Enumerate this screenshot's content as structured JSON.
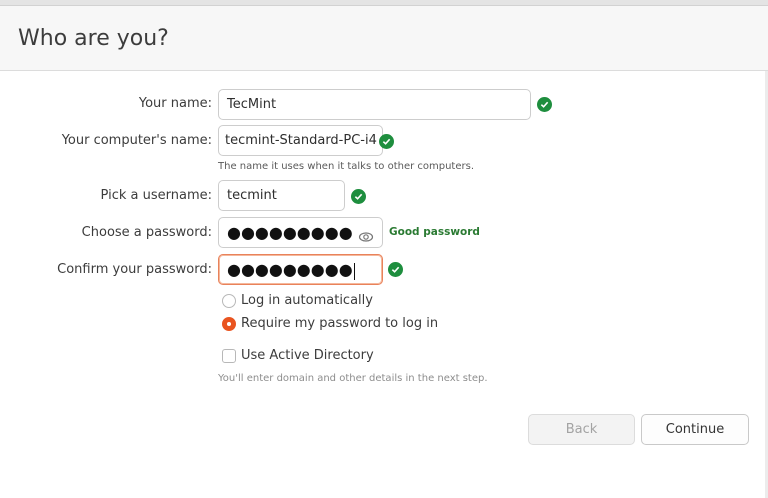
{
  "header": {
    "title": "Who are you?"
  },
  "form": {
    "name_label": "Your name:",
    "name_value": "TecMint",
    "computer_label": "Your computer's name:",
    "computer_value": "tecmint-Standard-PC-i4",
    "computer_hint": "The name it uses when it talks to other computers.",
    "username_label": "Pick a username:",
    "username_value": "tecmint",
    "password_label": "Choose a password:",
    "password_value": "●●●●●●●●●",
    "password_strength": "Good password",
    "confirm_label": "Confirm your password:",
    "confirm_value": "●●●●●●●●●"
  },
  "options": {
    "login_auto": "Log in automatically",
    "require_password": "Require my password to log in",
    "selected": "require_password",
    "active_directory": "Use Active Directory",
    "active_directory_checked": false,
    "ad_hint": "You'll enter domain and other details in the next step."
  },
  "buttons": {
    "back": "Back",
    "continue": "Continue"
  },
  "colors": {
    "accent": "#e95420",
    "success": "#1e8e3e",
    "focus_border": "#e9825b"
  },
  "icons": [
    "check-circle-icon",
    "eye-icon"
  ]
}
